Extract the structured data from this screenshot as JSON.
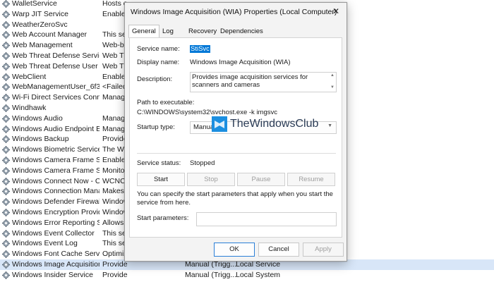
{
  "services": [
    {
      "name": "WalletService",
      "desc": "Hosts obj",
      "status": "",
      "logon": ""
    },
    {
      "name": "Warp JIT Service",
      "desc": "Enables",
      "status": "",
      "logon": ""
    },
    {
      "name": "WeatherZeroSvc",
      "desc": "",
      "status": "",
      "logon": ""
    },
    {
      "name": "Web Account Manager",
      "desc": "This serv",
      "status": "",
      "logon": ""
    },
    {
      "name": "Web Management",
      "desc": "Web-bas",
      "status": "",
      "logon": ""
    },
    {
      "name": "Web Threat Defense Service",
      "desc": "Web Thr",
      "status": "",
      "logon": ""
    },
    {
      "name": "Web Threat Defense User Se...",
      "desc": "Web Thr",
      "status": "",
      "logon": ""
    },
    {
      "name": "WebClient",
      "desc": "Enables",
      "status": "",
      "logon": ""
    },
    {
      "name": "WebManagementUser_6f3360",
      "desc": "<Failed",
      "status": "",
      "logon": ""
    },
    {
      "name": "Wi-Fi Direct Services Connec...",
      "desc": "Manage",
      "status": "",
      "logon": ""
    },
    {
      "name": "Windhawk",
      "desc": "",
      "status": "",
      "logon": ""
    },
    {
      "name": "Windows Audio",
      "desc": "Manage",
      "status": "",
      "logon": ""
    },
    {
      "name": "Windows Audio Endpoint B...",
      "desc": "Manage",
      "status": "",
      "logon": ""
    },
    {
      "name": "Windows Backup",
      "desc": "Provide",
      "status": "",
      "logon": ""
    },
    {
      "name": "Windows Biometric Service",
      "desc": "The Win",
      "status": "",
      "logon": ""
    },
    {
      "name": "Windows Camera Frame Ser...",
      "desc": "Enables",
      "status": "",
      "logon": ""
    },
    {
      "name": "Windows Camera Frame Ser...",
      "desc": "Monitor",
      "status": "",
      "logon": ""
    },
    {
      "name": "Windows Connect Now - Co...",
      "desc": "WCNCS",
      "status": "",
      "logon": ""
    },
    {
      "name": "Windows Connection Mana...",
      "desc": "Makes a",
      "status": "",
      "logon": ""
    },
    {
      "name": "Windows Defender Firewall",
      "desc": "Window",
      "status": "",
      "logon": ""
    },
    {
      "name": "Windows Encryption Provid...",
      "desc": "Window",
      "status": "",
      "logon": ""
    },
    {
      "name": "Windows Error Reporting Se...",
      "desc": "Allows e",
      "status": "",
      "logon": ""
    },
    {
      "name": "Windows Event Collector",
      "desc": "This serv",
      "status": "",
      "logon": ""
    },
    {
      "name": "Windows Event Log",
      "desc": "This serv",
      "status": "",
      "logon": ""
    },
    {
      "name": "Windows Font Cache Service",
      "desc": "Optimiz",
      "status": "",
      "logon": ""
    },
    {
      "name": "Windows Image Acquisition ...",
      "desc": "Provides ima...",
      "status": "Manual (Trigg...",
      "logon": "Local Service"
    },
    {
      "name": "Windows Insider Service",
      "desc": "Provides infr...",
      "status": "Manual (Trigg...",
      "logon": "Local System"
    }
  ],
  "dialog": {
    "title": "Windows Image Acquisition (WIA) Properties (Local Computer)",
    "close_glyph": "✕",
    "tabs": [
      "General",
      "Log On",
      "Recovery",
      "Dependencies"
    ],
    "service_name_label": "Service name:",
    "service_name": "StiSvc",
    "display_name_label": "Display name:",
    "display_name": "Windows Image Acquisition (WIA)",
    "description_label": "Description:",
    "description": "Provides image acquisition services for scanners and cameras",
    "path_label": "Path to executable:",
    "path": "C:\\WINDOWS\\system32\\svchost.exe -k imgsvc",
    "startup_label": "Startup type:",
    "startup_value": "Manual",
    "status_label": "Service status:",
    "status_value": "Stopped",
    "buttons": {
      "start": "Start",
      "stop": "Stop",
      "pause": "Pause",
      "resume": "Resume"
    },
    "info_text": "You can specify the start parameters that apply when you start the service from here.",
    "start_params_label": "Start parameters:",
    "start_params_value": "",
    "ok": "OK",
    "cancel": "Cancel",
    "apply": "Apply"
  },
  "watermark": {
    "text": "TheWindowsClub"
  },
  "colors": {
    "accent": "#0078d7",
    "selection_row": "#d8e6f8",
    "dialog_bg": "#f3f3f3"
  }
}
